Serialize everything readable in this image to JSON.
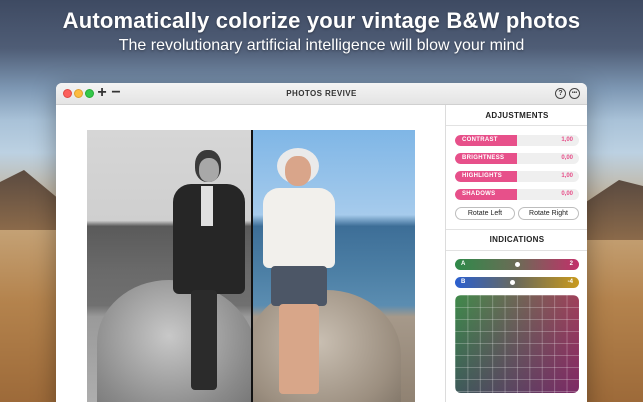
{
  "banner": {
    "headline": "Automatically colorize your vintage B&W photos",
    "subline": "The revolutionary artificial intelligence will blow your mind"
  },
  "window": {
    "title": "PHOTOS REVIVE",
    "add_label": "+",
    "remove_label": "−",
    "help_label": "?",
    "more_label": "•••"
  },
  "adjustments": {
    "heading": "ADJUSTMENTS",
    "sliders": [
      {
        "label": "CONTRAST",
        "value": "1,00",
        "level": 0.5
      },
      {
        "label": "BRIGHTNESS",
        "value": "0,00",
        "level": 0.5
      },
      {
        "label": "HIGHLIGHTS",
        "value": "1,00",
        "level": 0.5
      },
      {
        "label": "SHADOWS",
        "value": "0,00",
        "level": 0.5
      }
    ],
    "rotate_left": "Rotate Left",
    "rotate_right": "Rotate Right"
  },
  "indications": {
    "heading": "INDICATIONS",
    "a": {
      "label": "A",
      "value": "2",
      "level": 0.5
    },
    "b": {
      "label": "B",
      "value": "-4",
      "level": 0.45
    }
  },
  "colors": {
    "accent": "#e7508a"
  }
}
